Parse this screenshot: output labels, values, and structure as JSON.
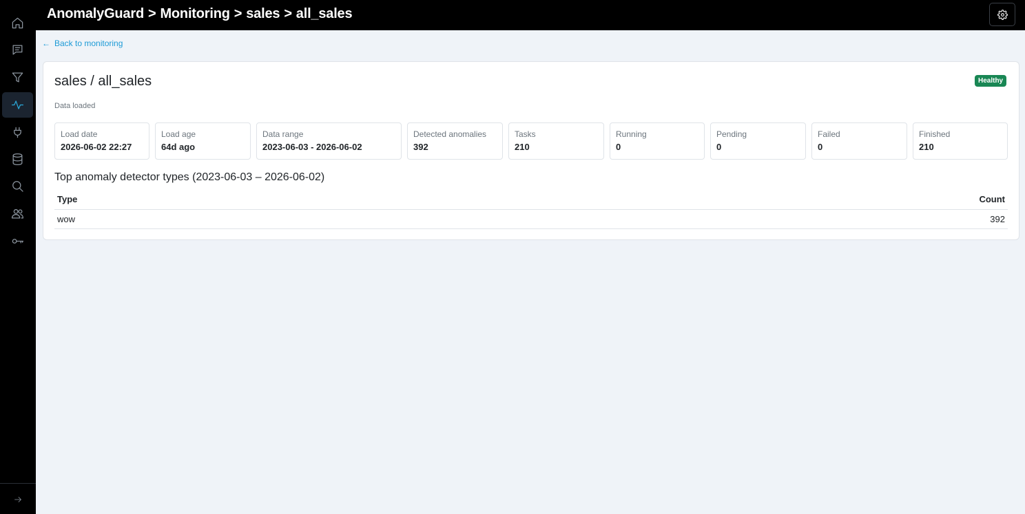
{
  "breadcrumb": {
    "app": "AnomalyGuard",
    "section": "Monitoring",
    "schema": "sales",
    "table": "all_sales",
    "separator": ">"
  },
  "sidebar": {
    "items": [
      {
        "name": "home",
        "icon": "home-icon",
        "active": false
      },
      {
        "name": "messages",
        "icon": "message-square-icon",
        "active": false
      },
      {
        "name": "filter",
        "icon": "funnel-icon",
        "active": false
      },
      {
        "name": "monitoring",
        "icon": "activity-pulse-icon",
        "active": true
      },
      {
        "name": "connections",
        "icon": "plug-icon",
        "active": false
      },
      {
        "name": "data-sources",
        "icon": "database-icon",
        "active": false
      },
      {
        "name": "search",
        "icon": "search-icon",
        "active": false
      },
      {
        "name": "users",
        "icon": "users-icon",
        "active": false
      },
      {
        "name": "api-keys",
        "icon": "key-icon",
        "active": false
      }
    ],
    "collapse_icon": "arrow-right-icon"
  },
  "header": {
    "settings_icon": "gear-icon"
  },
  "back_link": {
    "arrow": "←",
    "label": "Back to monitoring"
  },
  "card": {
    "title": "sales / all_sales",
    "status": "Healthy",
    "status_color": "#198754",
    "subtitle": "Data loaded",
    "stats": [
      {
        "label": "Load date",
        "value": "2026-06-02 22:27"
      },
      {
        "label": "Load age",
        "value": "64d ago"
      },
      {
        "label": "Data range",
        "value": "2023-06-03 - 2026-06-02"
      },
      {
        "label": "Detected anomalies",
        "value": "392"
      },
      {
        "label": "Tasks",
        "value": "210"
      },
      {
        "label": "Running",
        "value": "0"
      },
      {
        "label": "Pending",
        "value": "0"
      },
      {
        "label": "Failed",
        "value": "0"
      },
      {
        "label": "Finished",
        "value": "210"
      }
    ],
    "section_title": "Top anomaly detector types (2023-06-03 – 2026-06-02)",
    "table": {
      "columns": [
        "Type",
        "Count"
      ],
      "rows": [
        {
          "type": "wow",
          "count": "392"
        }
      ]
    }
  },
  "colors": {
    "accent": "#2ba8d8",
    "link": "#1c9ad6",
    "background": "#eff3f8",
    "topbar": "#000000"
  }
}
